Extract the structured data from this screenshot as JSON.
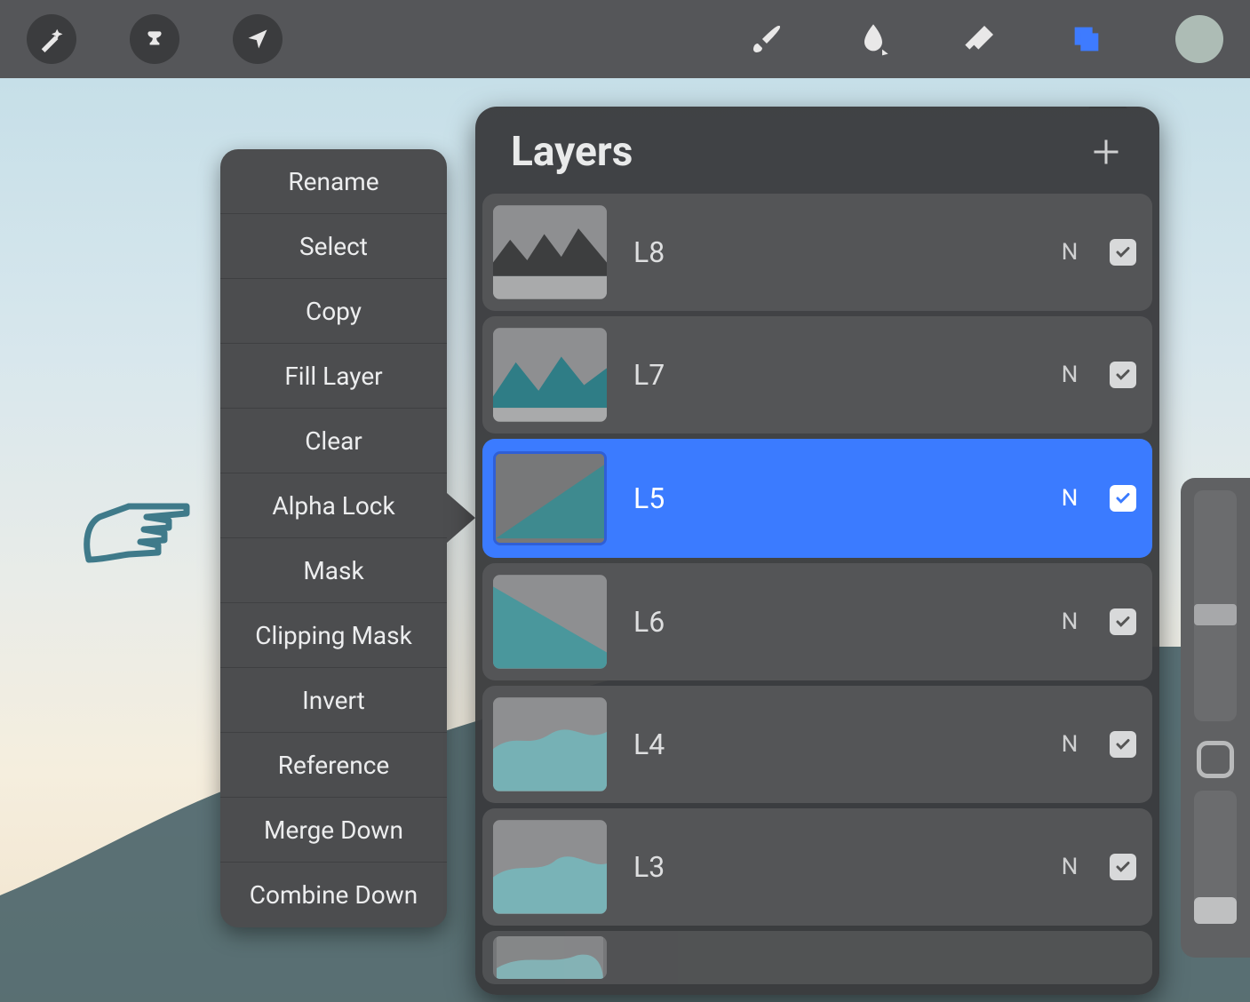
{
  "toolbar": {
    "left_tools": [
      "magic-wand-icon",
      "selection-icon",
      "transform-icon"
    ],
    "right_tools": [
      "brush-icon",
      "smudge-icon",
      "eraser-icon",
      "layers-icon"
    ],
    "active_tool": "layers-icon",
    "color_swatch": "#adbcb5"
  },
  "context_menu": {
    "items": [
      "Rename",
      "Select",
      "Copy",
      "Fill Layer",
      "Clear",
      "Alpha Lock",
      "Mask",
      "Clipping Mask",
      "Invert",
      "Reference",
      "Merge Down",
      "Combine Down"
    ]
  },
  "layers_panel": {
    "title": "Layers",
    "layers": [
      {
        "name": "L8",
        "blend": "N",
        "visible": true,
        "selected": false
      },
      {
        "name": "L7",
        "blend": "N",
        "visible": true,
        "selected": false
      },
      {
        "name": "L5",
        "blend": "N",
        "visible": true,
        "selected": true
      },
      {
        "name": "L6",
        "blend": "N",
        "visible": true,
        "selected": false
      },
      {
        "name": "L4",
        "blend": "N",
        "visible": true,
        "selected": false
      },
      {
        "name": "L3",
        "blend": "N",
        "visible": true,
        "selected": false
      }
    ]
  }
}
